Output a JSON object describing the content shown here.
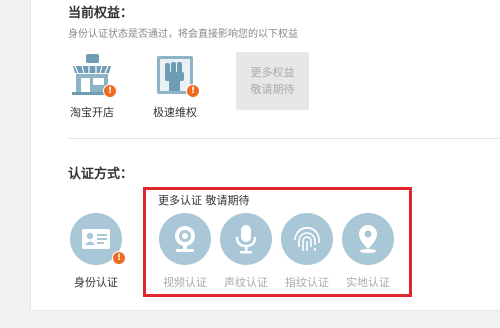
{
  "rights": {
    "heading": "当前权益：",
    "description": "身份认证状态是否通过，将会直接影响您的以下权益",
    "items": [
      {
        "label": "淘宝开店",
        "icon": "shop-icon",
        "badge": "!"
      },
      {
        "label": "极速维权",
        "icon": "fist-icon",
        "badge": "!"
      }
    ],
    "more_line1": "更多权益",
    "more_line2": "敬请期待"
  },
  "auth": {
    "heading": "认证方式：",
    "identity": {
      "label": "身份认证",
      "icon": "id-card-icon",
      "badge": "!"
    },
    "more_label": "更多认证 敬请期待",
    "methods": [
      {
        "label": "视频认证",
        "icon": "webcam-icon"
      },
      {
        "label": "声纹认证",
        "icon": "microphone-icon"
      },
      {
        "label": "指纹认证",
        "icon": "fingerprint-icon"
      },
      {
        "label": "实地认证",
        "icon": "location-pin-icon"
      }
    ]
  },
  "colors": {
    "circle": "#a9c7d6",
    "badge": "#ef6c1f",
    "highlight_box": "#e3262d"
  }
}
